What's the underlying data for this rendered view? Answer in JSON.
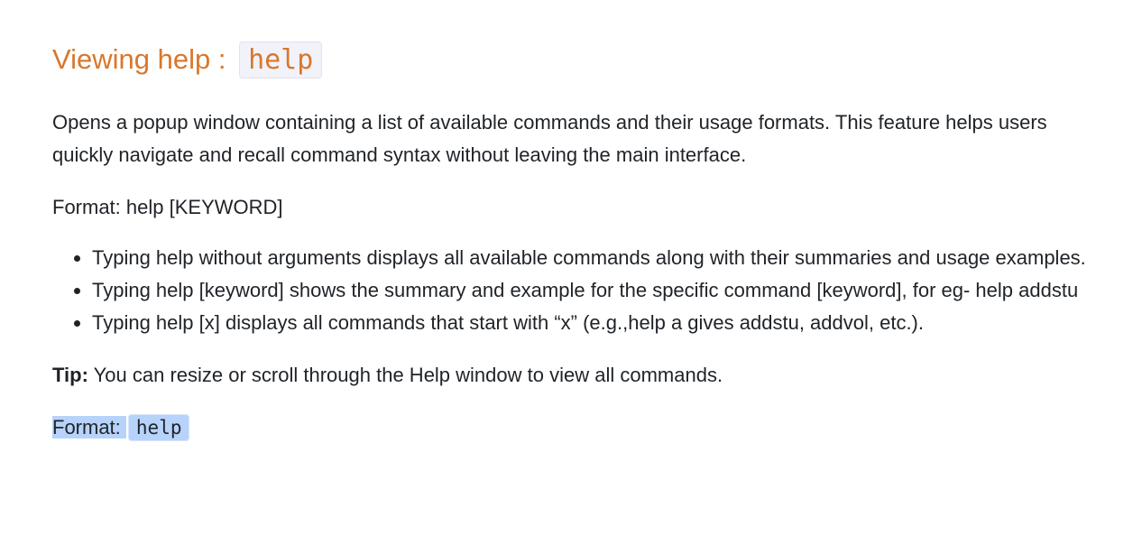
{
  "section": {
    "heading_text": "Viewing help : ",
    "heading_code": "help",
    "intro": "Opens a popup window containing a list of available commands and their usage formats. This feature helps users quickly navigate and recall command syntax without leaving the main interface.",
    "format_line": "Format: help [KEYWORD]",
    "bullets": [
      "Typing help without arguments displays all available commands along with their summaries and usage examples.",
      "Typing help [keyword] shows the summary and example for the specific command [keyword], for eg- help addstu",
      "Typing help [x] displays all commands that start with “x” (e.g.,help a gives addstu, addvol, etc.)."
    ],
    "tip_label": "Tip:",
    "tip_text": " You can resize or scroll through the Help window to view all commands.",
    "final_label": "Format: ",
    "final_code": "help"
  },
  "colors": {
    "heading": "#d9772b",
    "text": "#1f2328",
    "code_background": "#f2f2fa",
    "selection_highlight": "#b7d3fb"
  }
}
